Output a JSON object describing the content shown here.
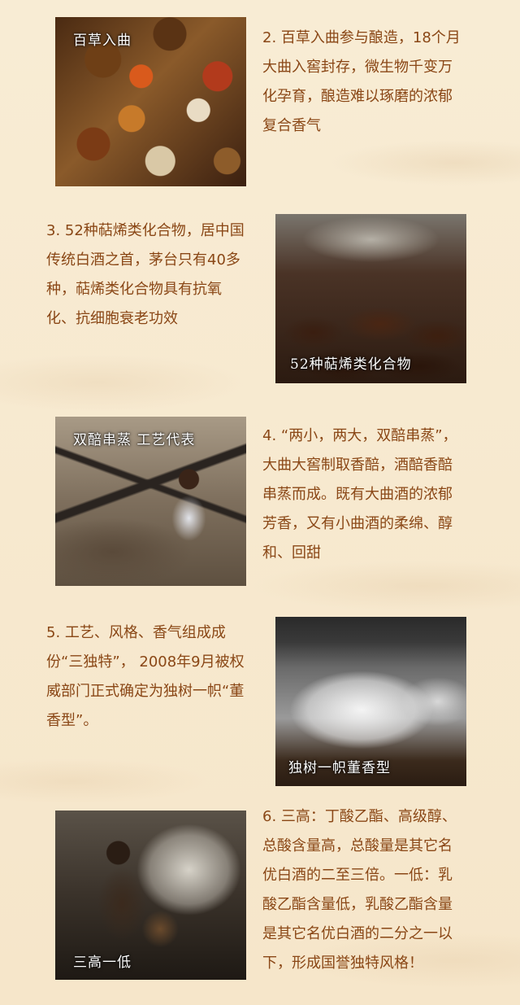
{
  "sections": [
    {
      "caption": "百草入曲",
      "text": "2. 百草入曲参与酿造，18个月大曲入窖封存，微生物千变万化孕育，酿造难以琢磨的浓郁复合香气"
    },
    {
      "caption": "52种萜烯类化合物",
      "text": "3. 52种萜烯类化合物，居中国传统白酒之首，茅台只有40多种，萜烯类化合物具有抗氧化、抗细胞衰老功效"
    },
    {
      "caption": "双醅串蒸 工艺代表",
      "text": "4. “两小，两大，双醅串蒸”，大曲大窖制取香醅，酒醅香醅串蒸而成。既有大曲酒的浓郁芳香，又有小曲酒的柔绵、醇和、回甜"
    },
    {
      "caption": "独树一帜董香型",
      "text": "5. 工艺、风格、香气组成成份“三独特”， 2008年9月被权威部门正式确定为独树一帜“董香型”。"
    },
    {
      "caption": "三高一低",
      "text": "6. 三高：丁酸乙酯、高级醇、总酸含量高，总酸量是其它名优白酒的二至三倍。一低：乳酸乙酯含量低，乳酸乙酯含量是其它名优白酒的二分之一以下，形成国誉独特风格！"
    }
  ]
}
